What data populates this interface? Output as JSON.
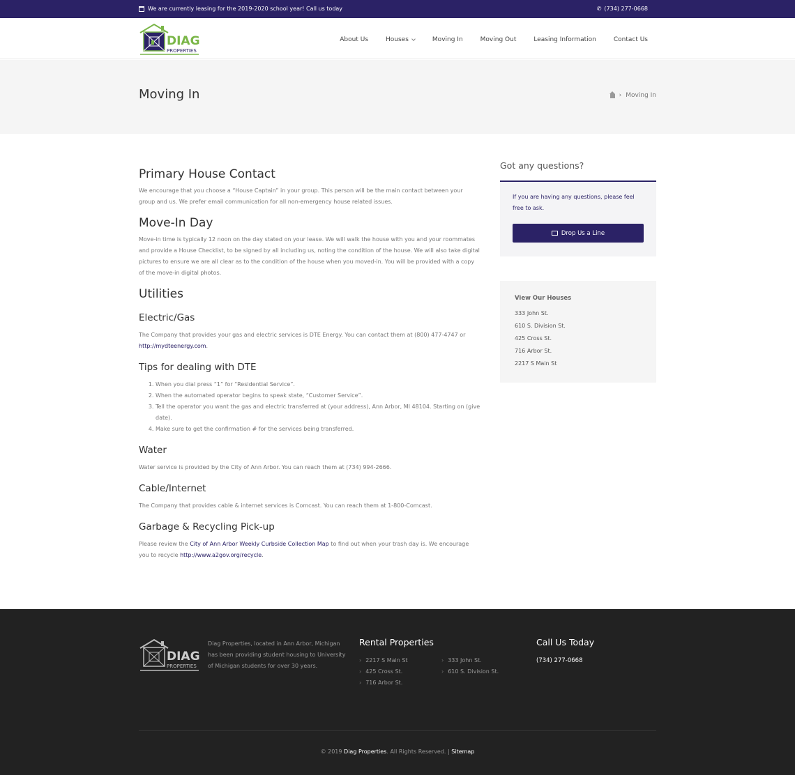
{
  "topbar": {
    "announcement": "We are currently leasing for the 2019-2020 school year! Call us today",
    "phone": "(734) 277-0668"
  },
  "header": {
    "logo_text_main": "DIAG",
    "logo_text_sub": "PROPERTIES",
    "nav": [
      "About Us",
      "Houses",
      "Moving In",
      "Moving Out",
      "Leasing Information",
      "Contact Us"
    ]
  },
  "titleband": {
    "title": "Moving In",
    "breadcrumb_current": "Moving In"
  },
  "main": {
    "primary_contact_heading": "Primary House Contact",
    "primary_contact_text": "We encourage that you choose a “House Captain” in your group. This person will be the main contact between your group and us. We prefer email communication for all non-emergency house related issues.",
    "move_in_heading": "Move-In Day",
    "move_in_text": "Move-in time is typically 12 noon on the day stated on your lease.  We will walk the house with you and your roommates and provide a House Checklist, to be signed by all including us, noting the condition of the house. We will also take digital pictures to ensure we are all clear as to the condition of the house when you moved-in.  You will be provided with a copy of the move-in digital photos.",
    "utilities_heading": "Utilities",
    "electric_heading": "Electric/Gas",
    "electric_text": "The Company that provides your gas and electric services is DTE Energy. You can contact them at (800) 477-4747 or ",
    "electric_link": "http://mydteenergy.com",
    "electric_end": ".",
    "tips_heading": "Tips for dealing with DTE",
    "tips": [
      "When you dial press “1” for “Residential Service”.",
      "When the automated operator begins to speak state, “Customer Service”.",
      "Tell the operator you want the gas and electric transferred at (your address), Ann Arbor, MI 48104. Starting on (give date).",
      "Make sure to get the confirmation # for the services being transferred."
    ],
    "water_heading": "Water",
    "water_text": "Water service is provided by the City of Ann Arbor. You can reach them at (734) 994-2666.",
    "cable_heading": "Cable/Internet",
    "cable_text": "The Company that provides cable & internet services is Comcast. You can reach them at 1-800-Comcast.",
    "garbage_heading": "Garbage & Recycling Pick-up",
    "garbage_text_1": "Please review the ",
    "garbage_link_1": "City of Ann Arbor Weekly Curbside Collection Map",
    "garbage_text_2": " to find out when your trash day is.  We encourage you to recycle ",
    "garbage_link_2": "http://www.a2gov.org/recycle",
    "garbage_text_3": "."
  },
  "sidebar": {
    "questions_heading": "Got any questions?",
    "questions_text": "If you are having any questions, please feel free to ask.",
    "button_label": "Drop Us a Line",
    "houses_heading": "View Our Houses",
    "houses": [
      "333 John St.",
      "610 S. Division St.",
      "425 Cross St.",
      "716 Arbor St.",
      "2217 S Main St"
    ]
  },
  "footer": {
    "about": "Diag Properties, located in Ann Arbor, Michigan has been providing student housing to University of Michigan students for over 30 years.",
    "rental_heading": "Rental Properties",
    "rentals": [
      "2217 S Main St",
      "333 John St.",
      "425 Cross St.",
      "610 S. Division St.",
      "716 Arbor St."
    ],
    "call_heading": "Call Us Today",
    "call_phone": "(734) 277-0668",
    "copy_prefix": "© 2019 ",
    "copy_company": "Diag Properties",
    "copy_middle": ". All Rights Reserved. | ",
    "copy_sitemap": "Sitemap"
  },
  "colors": {
    "brand": "#2b2266",
    "logo_green": "#7ab648",
    "footer_bg": "#222222"
  }
}
